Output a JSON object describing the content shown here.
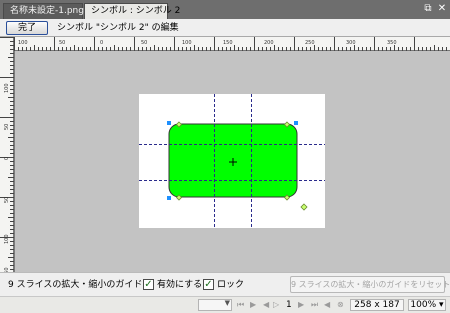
{
  "tabs": [
    {
      "label": "名称未設定-1.png*"
    },
    {
      "label": "シンボル : シンボル 2"
    }
  ],
  "window_controls": {
    "restore": "⧉",
    "close": "✕"
  },
  "edit_bar": {
    "done_label": "完了",
    "editing_label": "シンボル \"シンボル 2\" の編集"
  },
  "horizontal_ruler": {
    "labels": [
      "100",
      "50",
      "0",
      "50",
      "100",
      "150",
      "200",
      "250",
      "300",
      "350"
    ]
  },
  "vertical_ruler": {
    "labels": [
      "100",
      "50",
      "0",
      "50",
      "100",
      "150"
    ]
  },
  "guide_bar": {
    "label": "9 スライスの拡大・縮小のガイド :",
    "enable_label": "有効にする",
    "enable_checked": true,
    "lock_label": "ロック",
    "lock_checked": true,
    "reset_label": "9 スライスの拡大・縮小のガイドをリセット"
  },
  "status_bar": {
    "page": "1",
    "size": "258 x 187",
    "zoom": "100%"
  },
  "colors": {
    "shape_fill": "#00ff00",
    "guide_line": "#2a2a8c",
    "handle_blue": "#1e90ff",
    "handle_green": "#b9ff5a"
  }
}
